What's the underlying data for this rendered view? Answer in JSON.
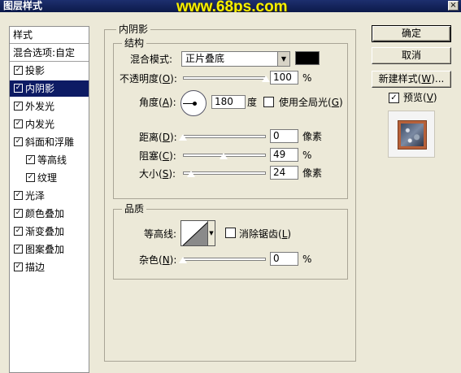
{
  "window": {
    "title": "图层样式",
    "watermark": "www.68ps.com",
    "close_glyph": "×"
  },
  "sidebar": {
    "header": "样式",
    "blend_options": "混合选项:自定",
    "items": [
      {
        "label": "投影",
        "checked": true,
        "selected": false,
        "indent": false
      },
      {
        "label": "内阴影",
        "checked": true,
        "selected": true,
        "indent": false
      },
      {
        "label": "外发光",
        "checked": true,
        "selected": false,
        "indent": false
      },
      {
        "label": "内发光",
        "checked": true,
        "selected": false,
        "indent": false
      },
      {
        "label": "斜面和浮雕",
        "checked": true,
        "selected": false,
        "indent": false
      },
      {
        "label": "等高线",
        "checked": true,
        "selected": false,
        "indent": true
      },
      {
        "label": "纹理",
        "checked": true,
        "selected": false,
        "indent": true
      },
      {
        "label": "光泽",
        "checked": true,
        "selected": false,
        "indent": false
      },
      {
        "label": "颜色叠加",
        "checked": true,
        "selected": false,
        "indent": false
      },
      {
        "label": "渐变叠加",
        "checked": true,
        "selected": false,
        "indent": false
      },
      {
        "label": "图案叠加",
        "checked": true,
        "selected": false,
        "indent": false
      },
      {
        "label": "描边",
        "checked": true,
        "selected": false,
        "indent": false
      }
    ],
    "check_glyph": "✓"
  },
  "panel": {
    "title": "内阴影",
    "structure": {
      "title": "结构",
      "blend_mode_label": "混合模式:",
      "blend_mode_key": "B",
      "blend_mode_value": "正片叠底",
      "blend_color": "#000000",
      "opacity_label_pre": "不透明度(",
      "opacity_key": "O",
      "label_post": "):",
      "opacity_value": "100",
      "opacity_unit": "%",
      "opacity_level": 1.0,
      "angle_label_pre": "角度(",
      "angle_key": "A",
      "angle_value": "180",
      "angle_unit": "度",
      "global_light_label_pre": "使用全局光(",
      "global_light_key": "G",
      "global_light_label_post": ")",
      "global_light_checked": false,
      "distance_label_pre": "距离(",
      "distance_key": "D",
      "distance_value": "0",
      "distance_unit": "像素",
      "distance_level": 0.0,
      "choke_label_pre": "阻塞(",
      "choke_key": "C",
      "choke_value": "49",
      "choke_unit": "%",
      "choke_level": 0.49,
      "size_label_pre": "大小(",
      "size_key": "S",
      "size_value": "24",
      "size_unit": "像素",
      "size_level": 0.1
    },
    "quality": {
      "title": "品质",
      "contour_label": "等高线:",
      "antialias_label_pre": "消除锯齿(",
      "antialias_key": "L",
      "antialias_label_post": ")",
      "antialias_checked": false,
      "noise_label_pre": "杂色(",
      "noise_key": "N",
      "noise_value": "0",
      "noise_unit": "%",
      "noise_level": 0.0
    }
  },
  "buttons": {
    "ok": "确定",
    "cancel": "取消",
    "new_style_pre": "新建样式(",
    "new_style_key": "W",
    "new_style_post": ")...",
    "preview_pre": "预览(",
    "preview_key": "V",
    "preview_post": ")",
    "preview_checked": true
  }
}
